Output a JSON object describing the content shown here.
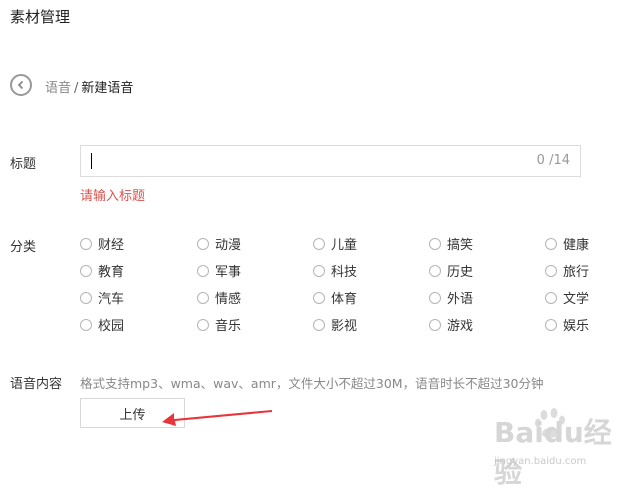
{
  "page_title": "素材管理",
  "breadcrumb": {
    "parent": "语音",
    "separator": "/",
    "current": "新建语音"
  },
  "form": {
    "title_label": "标题",
    "title_value": "",
    "title_count": "0 /14",
    "title_error": "请输入标题",
    "category_label": "分类",
    "categories": [
      "财经",
      "动漫",
      "儿童",
      "搞笑",
      "健康",
      "教育",
      "军事",
      "科技",
      "历史",
      "旅行",
      "汽车",
      "情感",
      "体育",
      "外语",
      "文学",
      "校园",
      "音乐",
      "影视",
      "游戏",
      "娱乐"
    ],
    "content_label": "语音内容",
    "content_hint": "格式支持mp3、wma、wav、amr，文件大小不超过30M，语音时长不超过30分钟",
    "upload_label": "上传"
  },
  "watermark": {
    "logo": "Baidu经验",
    "url": "jingyan.baidu.com"
  },
  "colors": {
    "error": "#d9534f",
    "arrow": "#e8343a"
  }
}
